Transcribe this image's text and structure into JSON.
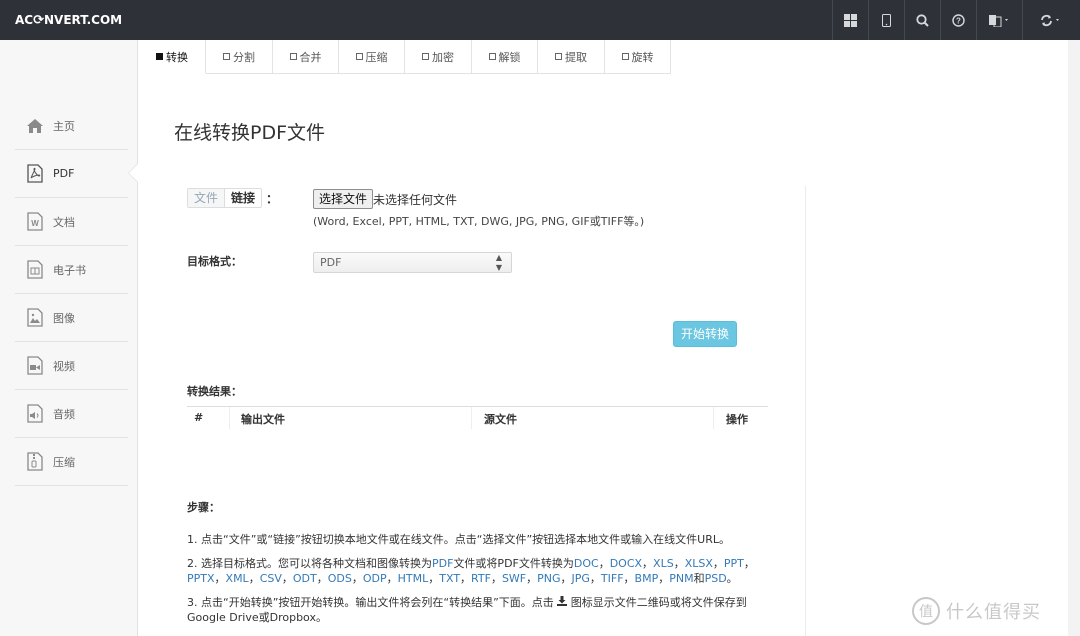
{
  "brand": {
    "pre": "AC",
    "post": "NVERT.COM"
  },
  "nav": {
    "icons": [
      "grid-icon",
      "tablet-icon",
      "search-icon",
      "help-icon",
      "language-icon",
      "refresh-icon"
    ]
  },
  "sidebar": {
    "items": [
      {
        "label": "主页",
        "icon": "home-icon"
      },
      {
        "label": "PDF",
        "icon": "pdf-file-icon",
        "active": true
      },
      {
        "label": "文档",
        "icon": "word-file-icon"
      },
      {
        "label": "电子书",
        "icon": "ebook-file-icon"
      },
      {
        "label": "图像",
        "icon": "image-file-icon"
      },
      {
        "label": "视频",
        "icon": "video-file-icon"
      },
      {
        "label": "音频",
        "icon": "audio-file-icon"
      },
      {
        "label": "压缩",
        "icon": "archive-file-icon"
      }
    ]
  },
  "tabs": [
    "转换",
    "分割",
    "合并",
    "压缩",
    "加密",
    "解锁",
    "提取",
    "旋转"
  ],
  "page_title": "在线转换PDF文件",
  "source": {
    "tab_file": "文件",
    "tab_link": "链接",
    "colon": "：",
    "choose_label": "选择文件",
    "status": "未选择任何文件",
    "hint": "(Word, Excel, PPT, HTML, TXT, DWG, JPG, PNG, GIF或TIFF等。)"
  },
  "target": {
    "label": "目标格式：",
    "value": "PDF"
  },
  "convert_label": "开始转换",
  "results": {
    "label": "转换结果：",
    "cols": [
      "#",
      "输出文件",
      "源文件",
      "操作"
    ]
  },
  "steps": {
    "title": "步骤：",
    "s1": "1. 点击“文件”或“链接”按钮切换本地文件或在线文件。点击“选择文件”按钮选择本地文件或输入在线文件URL。",
    "s2_a": "2. 选择目标格式。您可以将各种文档和图像转换为",
    "s2_pdf": "PDF",
    "s2_b": "文件或将PDF文件转换为",
    "s2_formats": [
      "DOC",
      "DOCX",
      "XLS",
      "XLSX",
      "PPT",
      "PPTX",
      "XML",
      "CSV",
      "ODT",
      "ODS",
      "ODP",
      "HTML",
      "TXT",
      "RTF",
      "SWF",
      "PNG",
      "JPG",
      "TIFF",
      "BMP",
      "PNM"
    ],
    "s2_and": "和",
    "s2_last": "PSD",
    "s2_end": "。",
    "s3_a": "3. 点击“开始转换”按钮开始转换。输出文件将会列在“转换结果”下面。点击 ",
    "s3_b": " 图标显示文件二维码或将文件保存到Google Drive或Dropbox。"
  },
  "watermark": {
    "glyph": "值",
    "text": "什么值得买"
  }
}
